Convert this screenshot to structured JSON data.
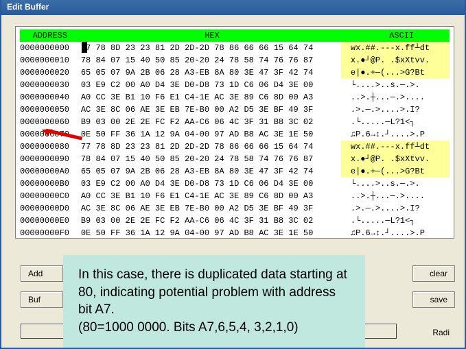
{
  "title": "Edit Buffer",
  "headers": {
    "addr": "ADDRESS",
    "hex": "HEX",
    "ascii": "ASCII"
  },
  "rows": [
    {
      "addr": "0000000000",
      "hex": "77 78 8D 23 23 81 2D 2D-2D 78 86 66 66 15 64 74",
      "ascii": "wx.##.---x.ff┴dt",
      "hi": true
    },
    {
      "addr": "0000000010",
      "hex": "78 84 07 15 40 50 85 20-20 24 78 58 74 76 76 87",
      "ascii": "x.●┘@P. .$xXtvv.",
      "hi": true
    },
    {
      "addr": "0000000020",
      "hex": "65 05 07 9A 2B 06 28 A3-EB 8A 80 3E 47 3F 42 74",
      "ascii": "e|●.+─(...>G?Bt",
      "hi": true
    },
    {
      "addr": "0000000030",
      "hex": "03 E9 C2 00 A0 D4 3E D0-D8 73 1D C6 06 D4 3E 00",
      "ascii": "└....>..s.─.>.",
      "hi": false
    },
    {
      "addr": "0000000040",
      "hex": "A0 CC 3E B1 10 F6 E1 C4-1E AC 3E 89 C6 8D 00 A3",
      "ascii": "..>.┼...─.>....",
      "hi": false
    },
    {
      "addr": "0000000050",
      "hex": "AC 3E 8C 06 AE 3E EB 7E-B0 00 A2 D5 3E BF 49 3F",
      "ascii": ".>.─.>....>.I?",
      "hi": false
    },
    {
      "addr": "0000000060",
      "hex": "B9 03 00 2E 2E FC F2 AA-C6 06 4C 3F 31 B8 3C 02",
      "ascii": ".└.....─L?1<┐",
      "hi": false
    },
    {
      "addr": "0000000070",
      "hex": "0E 50 FF 36 1A 12 9A 04-00 97 AD B8 AC 3E 1E 50",
      "ascii": "♫P.6→↕.┘....>.P",
      "hi": false
    },
    {
      "addr": "0000000080",
      "hex": "77 78 8D 23 23 81 2D 2D-2D 78 86 66 66 15 64 74",
      "ascii": "wx.##.---x.ff┴dt",
      "hi": true
    },
    {
      "addr": "0000000090",
      "hex": "78 84 07 15 40 50 85 20-20 24 78 58 74 76 76 87",
      "ascii": "x.●┘@P. .$xXtvv.",
      "hi": true
    },
    {
      "addr": "00000000A0",
      "hex": "65 05 07 9A 2B 06 28 A3-EB 8A 80 3E 47 3F 42 74",
      "ascii": "e|●.+─(...>G?Bt",
      "hi": true
    },
    {
      "addr": "00000000B0",
      "hex": "03 E9 C2 00 A0 D4 3E D0-D8 73 1D C6 06 D4 3E 00",
      "ascii": "└....>..s.─.>.",
      "hi": false
    },
    {
      "addr": "00000000C0",
      "hex": "A0 CC 3E B1 10 F6 E1 C4-1E AC 3E 89 C6 8D 00 A3",
      "ascii": "..>.┼...─.>....",
      "hi": false
    },
    {
      "addr": "00000000D0",
      "hex": "AC 3E 8C 06 AE 3E EB 7E-B0 00 A2 D5 3E BF 49 3F",
      "ascii": ".>.─.>....>.I?",
      "hi": false
    },
    {
      "addr": "00000000E0",
      "hex": "B9 03 00 2E 2E FC F2 AA-C6 06 4C 3F 31 B8 3C 02",
      "ascii": ".└.....─L?1<┐",
      "hi": false
    },
    {
      "addr": "00000000F0",
      "hex": "0E 50 FF 36 1A 12 9A 04-00 97 AD B8 AC 3E 1E 50",
      "ascii": "♫P.6→↕.┘....>.P",
      "hi": false
    }
  ],
  "annotation": "In this case, there is duplicated data starting at 80, indicating potential problem with address bit A7.\n(80=1000 0000. Bits A7,6,5,4,  3,2,1,0)",
  "buttons": {
    "left1": "Add",
    "left2": "Buf",
    "right1": "clear",
    "right2": "save",
    "radix": "Radi"
  }
}
